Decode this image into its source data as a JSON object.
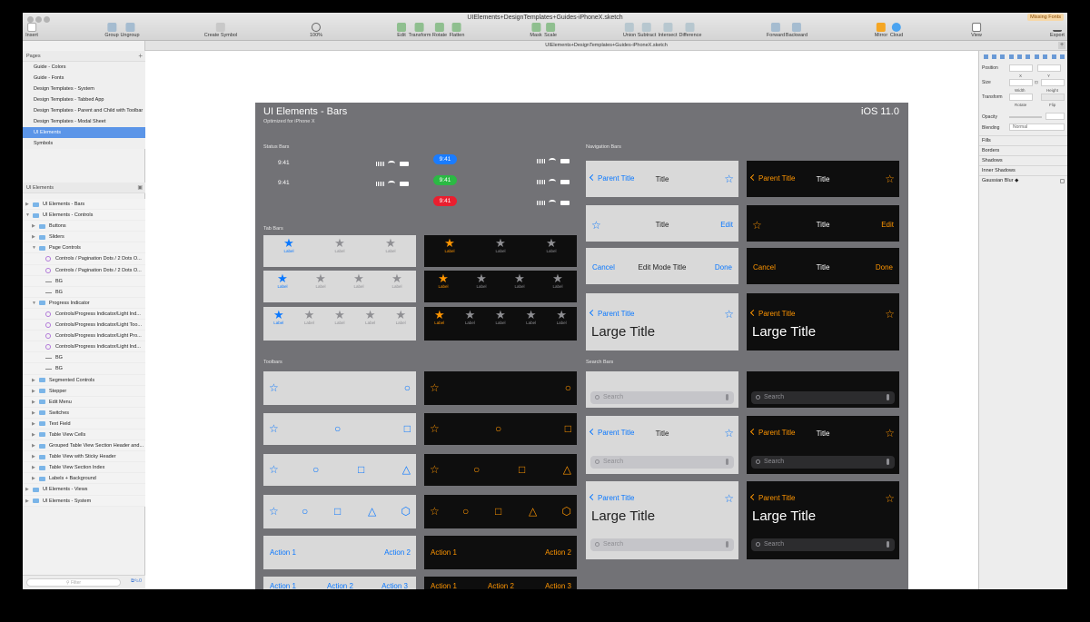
{
  "window": {
    "title": "UIElements+DesignTemplates+Guides-iPhoneX.sketch",
    "missing_fonts": "Missing Fonts"
  },
  "toolbar": {
    "insert": "Insert",
    "group": "Group",
    "ungroup": "Ungroup",
    "create_symbol": "Create Symbol",
    "zoom_label": "100%",
    "edit": "Edit",
    "transform": "Transform",
    "rotate": "Rotate",
    "flatten": "Flatten",
    "mask": "Mask",
    "scale": "Scale",
    "union": "Union",
    "subtract": "Subtract",
    "intersect": "Intersect",
    "difference": "Difference",
    "forward": "Forward",
    "backward": "Backward",
    "mirror": "Mirror",
    "cloud": "Cloud",
    "view": "View",
    "export": "Export"
  },
  "docbar": {
    "title": "UIElements+DesignTemplates+Guides-iPhoneX.sketch"
  },
  "pages": {
    "header": "Pages",
    "items": [
      {
        "label": "Guide - Colors"
      },
      {
        "label": "Guide - Fonts"
      },
      {
        "label": "Design Templates - System"
      },
      {
        "label": "Design Templates - Tabbed App"
      },
      {
        "label": "Design Templates - Parent and Child with Toolbar"
      },
      {
        "label": "Design Templates - Modal Sheet"
      },
      {
        "label": "UI Elements",
        "selected": true
      },
      {
        "label": "Symbols"
      }
    ]
  },
  "layers": {
    "header": "UI Elements",
    "items": [
      {
        "label": "UI Elements - Bars",
        "indent": 0,
        "icon": "folder",
        "expand": "closed"
      },
      {
        "label": "UI Elements - Controls",
        "indent": 0,
        "icon": "folder",
        "expand": "open"
      },
      {
        "label": "Buttons",
        "indent": 1,
        "icon": "folder",
        "expand": "closed"
      },
      {
        "label": "Sliders",
        "indent": 1,
        "icon": "folder",
        "expand": "closed"
      },
      {
        "label": "Page Controls",
        "indent": 1,
        "icon": "folder",
        "expand": "open"
      },
      {
        "label": "Controls / Pagination Dots / 2 Dots O...",
        "indent": 2,
        "icon": "symbol"
      },
      {
        "label": "Controls / Pagination Dots / 2 Dots O...",
        "indent": 2,
        "icon": "symbol"
      },
      {
        "label": "BG",
        "indent": 2,
        "icon": "rect"
      },
      {
        "label": "BG",
        "indent": 2,
        "icon": "rect"
      },
      {
        "label": "Progress Indicator",
        "indent": 1,
        "icon": "folder",
        "expand": "open"
      },
      {
        "label": "Controls/Progress Indicator/Light Ind...",
        "indent": 2,
        "icon": "symbol"
      },
      {
        "label": "Controls/Progress Indicator/Light Too...",
        "indent": 2,
        "icon": "symbol"
      },
      {
        "label": "Controls/Progress Indicator/Light Pro...",
        "indent": 2,
        "icon": "symbol"
      },
      {
        "label": "Controls/Progress Indicator/Light Ind...",
        "indent": 2,
        "icon": "symbol"
      },
      {
        "label": "BG",
        "indent": 2,
        "icon": "rect"
      },
      {
        "label": "BG",
        "indent": 2,
        "icon": "rect"
      },
      {
        "label": "Segmented Controls",
        "indent": 1,
        "icon": "folder",
        "expand": "closed"
      },
      {
        "label": "Stepper",
        "indent": 1,
        "icon": "folder",
        "expand": "closed"
      },
      {
        "label": "Edit Menu",
        "indent": 1,
        "icon": "folder",
        "expand": "closed"
      },
      {
        "label": "Switches",
        "indent": 1,
        "icon": "folder",
        "expand": "closed"
      },
      {
        "label": "Text Field",
        "indent": 1,
        "icon": "folder",
        "expand": "closed"
      },
      {
        "label": "Table View Cells",
        "indent": 1,
        "icon": "folder",
        "expand": "closed"
      },
      {
        "label": "Grouped Table View Section Header and...",
        "indent": 1,
        "icon": "folder",
        "expand": "closed"
      },
      {
        "label": "Table View with Sticky Header",
        "indent": 1,
        "icon": "folder",
        "expand": "closed"
      },
      {
        "label": "Table View Section Index",
        "indent": 1,
        "icon": "folder",
        "expand": "closed"
      },
      {
        "label": "Labels + Background",
        "indent": 1,
        "icon": "folder",
        "expand": "closed"
      },
      {
        "label": "UI Elements - Views",
        "indent": 0,
        "icon": "folder",
        "expand": "closed"
      },
      {
        "label": "UI Elements - System",
        "indent": 0,
        "icon": "folder",
        "expand": "closed"
      }
    ],
    "filter_placeholder": "Filter"
  },
  "artboard": {
    "title": "UI Elements - Bars",
    "subtitle": "Optimized for iPhone X",
    "version": "iOS 11.0",
    "sections": {
      "status_bars": "Status Bars",
      "navigation_bars": "Navigation Bars",
      "tab_bars": "Tab Bars",
      "toolbars": "Toolbars",
      "search_bars": "Search Bars"
    },
    "status_bars": {
      "time": "9:41",
      "pill_colors": [
        "#1a7cff",
        "#2bb944",
        "#ea1f2f"
      ]
    },
    "tab_label": "Label",
    "nav": {
      "parent_title": "Parent Title",
      "title": "Title",
      "edit": "Edit",
      "cancel": "Cancel",
      "done": "Done",
      "edit_mode_title": "Edit Mode Title",
      "large_title": "Large Title"
    },
    "search_placeholder": "Search",
    "toolbar_actions": {
      "a1": "Action 1",
      "a2": "Action 2",
      "a3": "Action 3"
    },
    "colors": {
      "tint_light": "#0a78ff",
      "tint_dark": "#ff9500",
      "artboard_bg": "#727276"
    }
  },
  "inspector": {
    "position": "Position",
    "x": "X",
    "y": "Y",
    "size": "Size",
    "width": "Width",
    "height": "Height",
    "transform": "Transform",
    "rotate": "Rotate",
    "flip": "Flip",
    "opacity": "Opacity",
    "blending": "Blending",
    "blending_value": "Normal",
    "fills": "Fills",
    "borders": "Borders",
    "shadows": "Shadows",
    "inner_shadows": "Inner Shadows",
    "gaussian_blur": "Gaussian Blur"
  }
}
